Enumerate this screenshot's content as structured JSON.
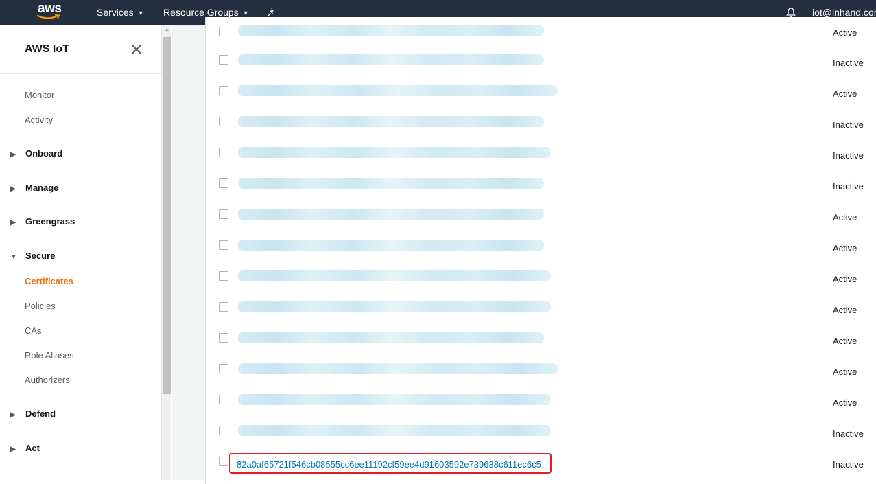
{
  "topbar": {
    "logo_text": "aws",
    "services_label": "Services",
    "resource_groups_label": "Resource Groups",
    "user_label": "iot@inhand.com"
  },
  "sidebar": {
    "title": "AWS IoT",
    "links_top": [
      "Monitor",
      "Activity"
    ],
    "groups": {
      "onboard": "Onboard",
      "manage": "Manage",
      "greengrass": "Greengrass",
      "secure": "Secure",
      "defend": "Defend",
      "act": "Act"
    },
    "secure_items": [
      "Certificates",
      "Policies",
      "CAs",
      "Role Aliases",
      "Authorizers"
    ],
    "active_item": "Certificates"
  },
  "table": {
    "rows": [
      {
        "status": "Active"
      },
      {
        "status": "Inactive"
      },
      {
        "status": "Active"
      },
      {
        "status": "Inactive"
      },
      {
        "status": "Inactive"
      },
      {
        "status": "Inactive"
      },
      {
        "status": "Active"
      },
      {
        "status": "Active"
      },
      {
        "status": "Active"
      },
      {
        "status": "Active"
      },
      {
        "status": "Active"
      },
      {
        "status": "Active"
      },
      {
        "status": "Active"
      },
      {
        "status": "Inactive"
      },
      {
        "status": "Inactive",
        "certificate_id": "82a0af65721f546cb08555cc6ee11192cf59ee4d91603592e739638c611ec6c5"
      }
    ]
  },
  "colors": {
    "topbar_bg": "#232f3e",
    "active_link": "#ec7211",
    "link": "#0073bb",
    "highlight_border": "#e02020"
  }
}
